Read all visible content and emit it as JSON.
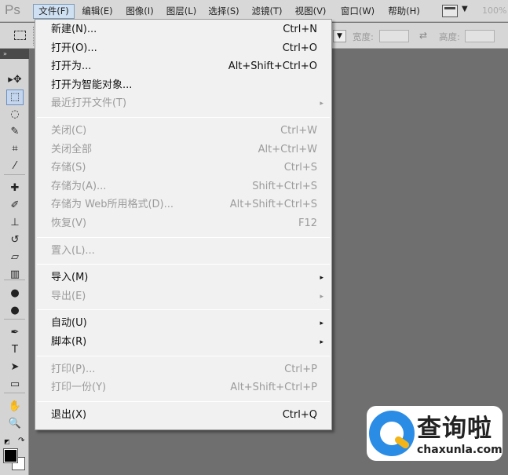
{
  "app": {
    "logo": "Ps",
    "zoom": "100%"
  },
  "menubar": {
    "items": [
      {
        "label": "文件(F)"
      },
      {
        "label": "编辑(E)"
      },
      {
        "label": "图像(I)"
      },
      {
        "label": "图层(L)"
      },
      {
        "label": "选择(S)"
      },
      {
        "label": "滤镜(T)"
      },
      {
        "label": "视图(V)"
      },
      {
        "label": "窗口(W)"
      },
      {
        "label": "帮助(H)"
      }
    ],
    "active": "文件(F)"
  },
  "options": {
    "width_label": "宽度:",
    "height_label": "高度:",
    "dropdown_arrow": "▼"
  },
  "toolbox": {
    "header": "»",
    "tools": [
      {
        "name": "move-tool",
        "glyph": "▸✥"
      },
      {
        "name": "marquee-tool",
        "glyph": "⬚"
      },
      {
        "name": "lasso-tool",
        "glyph": "◌"
      },
      {
        "name": "quick-selection-tool",
        "glyph": "✎"
      },
      {
        "name": "crop-tool",
        "glyph": "⌗"
      },
      {
        "name": "eyedropper-tool",
        "glyph": "⁄"
      },
      {
        "name": "healing-brush-tool",
        "glyph": "✚"
      },
      {
        "name": "brush-tool",
        "glyph": "✐"
      },
      {
        "name": "clone-stamp-tool",
        "glyph": "⊥"
      },
      {
        "name": "history-brush-tool",
        "glyph": "↺"
      },
      {
        "name": "eraser-tool",
        "glyph": "▱"
      },
      {
        "name": "gradient-tool",
        "glyph": "▥"
      },
      {
        "name": "blur-tool",
        "glyph": "●"
      },
      {
        "name": "dodge-tool",
        "glyph": "●"
      },
      {
        "name": "pen-tool",
        "glyph": "✒"
      },
      {
        "name": "type-tool",
        "glyph": "T"
      },
      {
        "name": "path-selection-tool",
        "glyph": "➤"
      },
      {
        "name": "shape-tool",
        "glyph": "▭"
      },
      {
        "name": "hand-tool",
        "glyph": "✋"
      },
      {
        "name": "zoom-tool",
        "glyph": "🔍"
      }
    ],
    "selected": "marquee-tool"
  },
  "file_menu": {
    "groups": [
      [
        {
          "label": "新建(N)...",
          "shortcut": "Ctrl+N",
          "enabled": true
        },
        {
          "label": "打开(O)...",
          "shortcut": "Ctrl+O",
          "enabled": true
        },
        {
          "label": "打开为...",
          "shortcut": "Alt+Shift+Ctrl+O",
          "enabled": true
        },
        {
          "label": "打开为智能对象...",
          "shortcut": "",
          "enabled": true
        },
        {
          "label": "最近打开文件(T)",
          "shortcut": "",
          "enabled": false,
          "submenu": true
        }
      ],
      [
        {
          "label": "关闭(C)",
          "shortcut": "Ctrl+W",
          "enabled": false
        },
        {
          "label": "关闭全部",
          "shortcut": "Alt+Ctrl+W",
          "enabled": false
        },
        {
          "label": "存储(S)",
          "shortcut": "Ctrl+S",
          "enabled": false
        },
        {
          "label": "存储为(A)...",
          "shortcut": "Shift+Ctrl+S",
          "enabled": false
        },
        {
          "label": "存储为 Web所用格式(D)...",
          "shortcut": "Alt+Shift+Ctrl+S",
          "enabled": false
        },
        {
          "label": "恢复(V)",
          "shortcut": "F12",
          "enabled": false
        }
      ],
      [
        {
          "label": "置入(L)...",
          "shortcut": "",
          "enabled": false
        }
      ],
      [
        {
          "label": "导入(M)",
          "shortcut": "",
          "enabled": true,
          "submenu": true
        },
        {
          "label": "导出(E)",
          "shortcut": "",
          "enabled": false,
          "submenu": true
        }
      ],
      [
        {
          "label": "自动(U)",
          "shortcut": "",
          "enabled": true,
          "submenu": true
        },
        {
          "label": "脚本(R)",
          "shortcut": "",
          "enabled": true,
          "submenu": true
        }
      ],
      [
        {
          "label": "打印(P)...",
          "shortcut": "Ctrl+P",
          "enabled": false
        },
        {
          "label": "打印一份(Y)",
          "shortcut": "Alt+Shift+Ctrl+P",
          "enabled": false
        }
      ],
      [
        {
          "label": "退出(X)",
          "shortcut": "Ctrl+Q",
          "enabled": true
        }
      ]
    ],
    "submenu_arrow": "▸"
  },
  "watermark": {
    "title": "查询啦",
    "subtitle": "chaxunla.com"
  }
}
